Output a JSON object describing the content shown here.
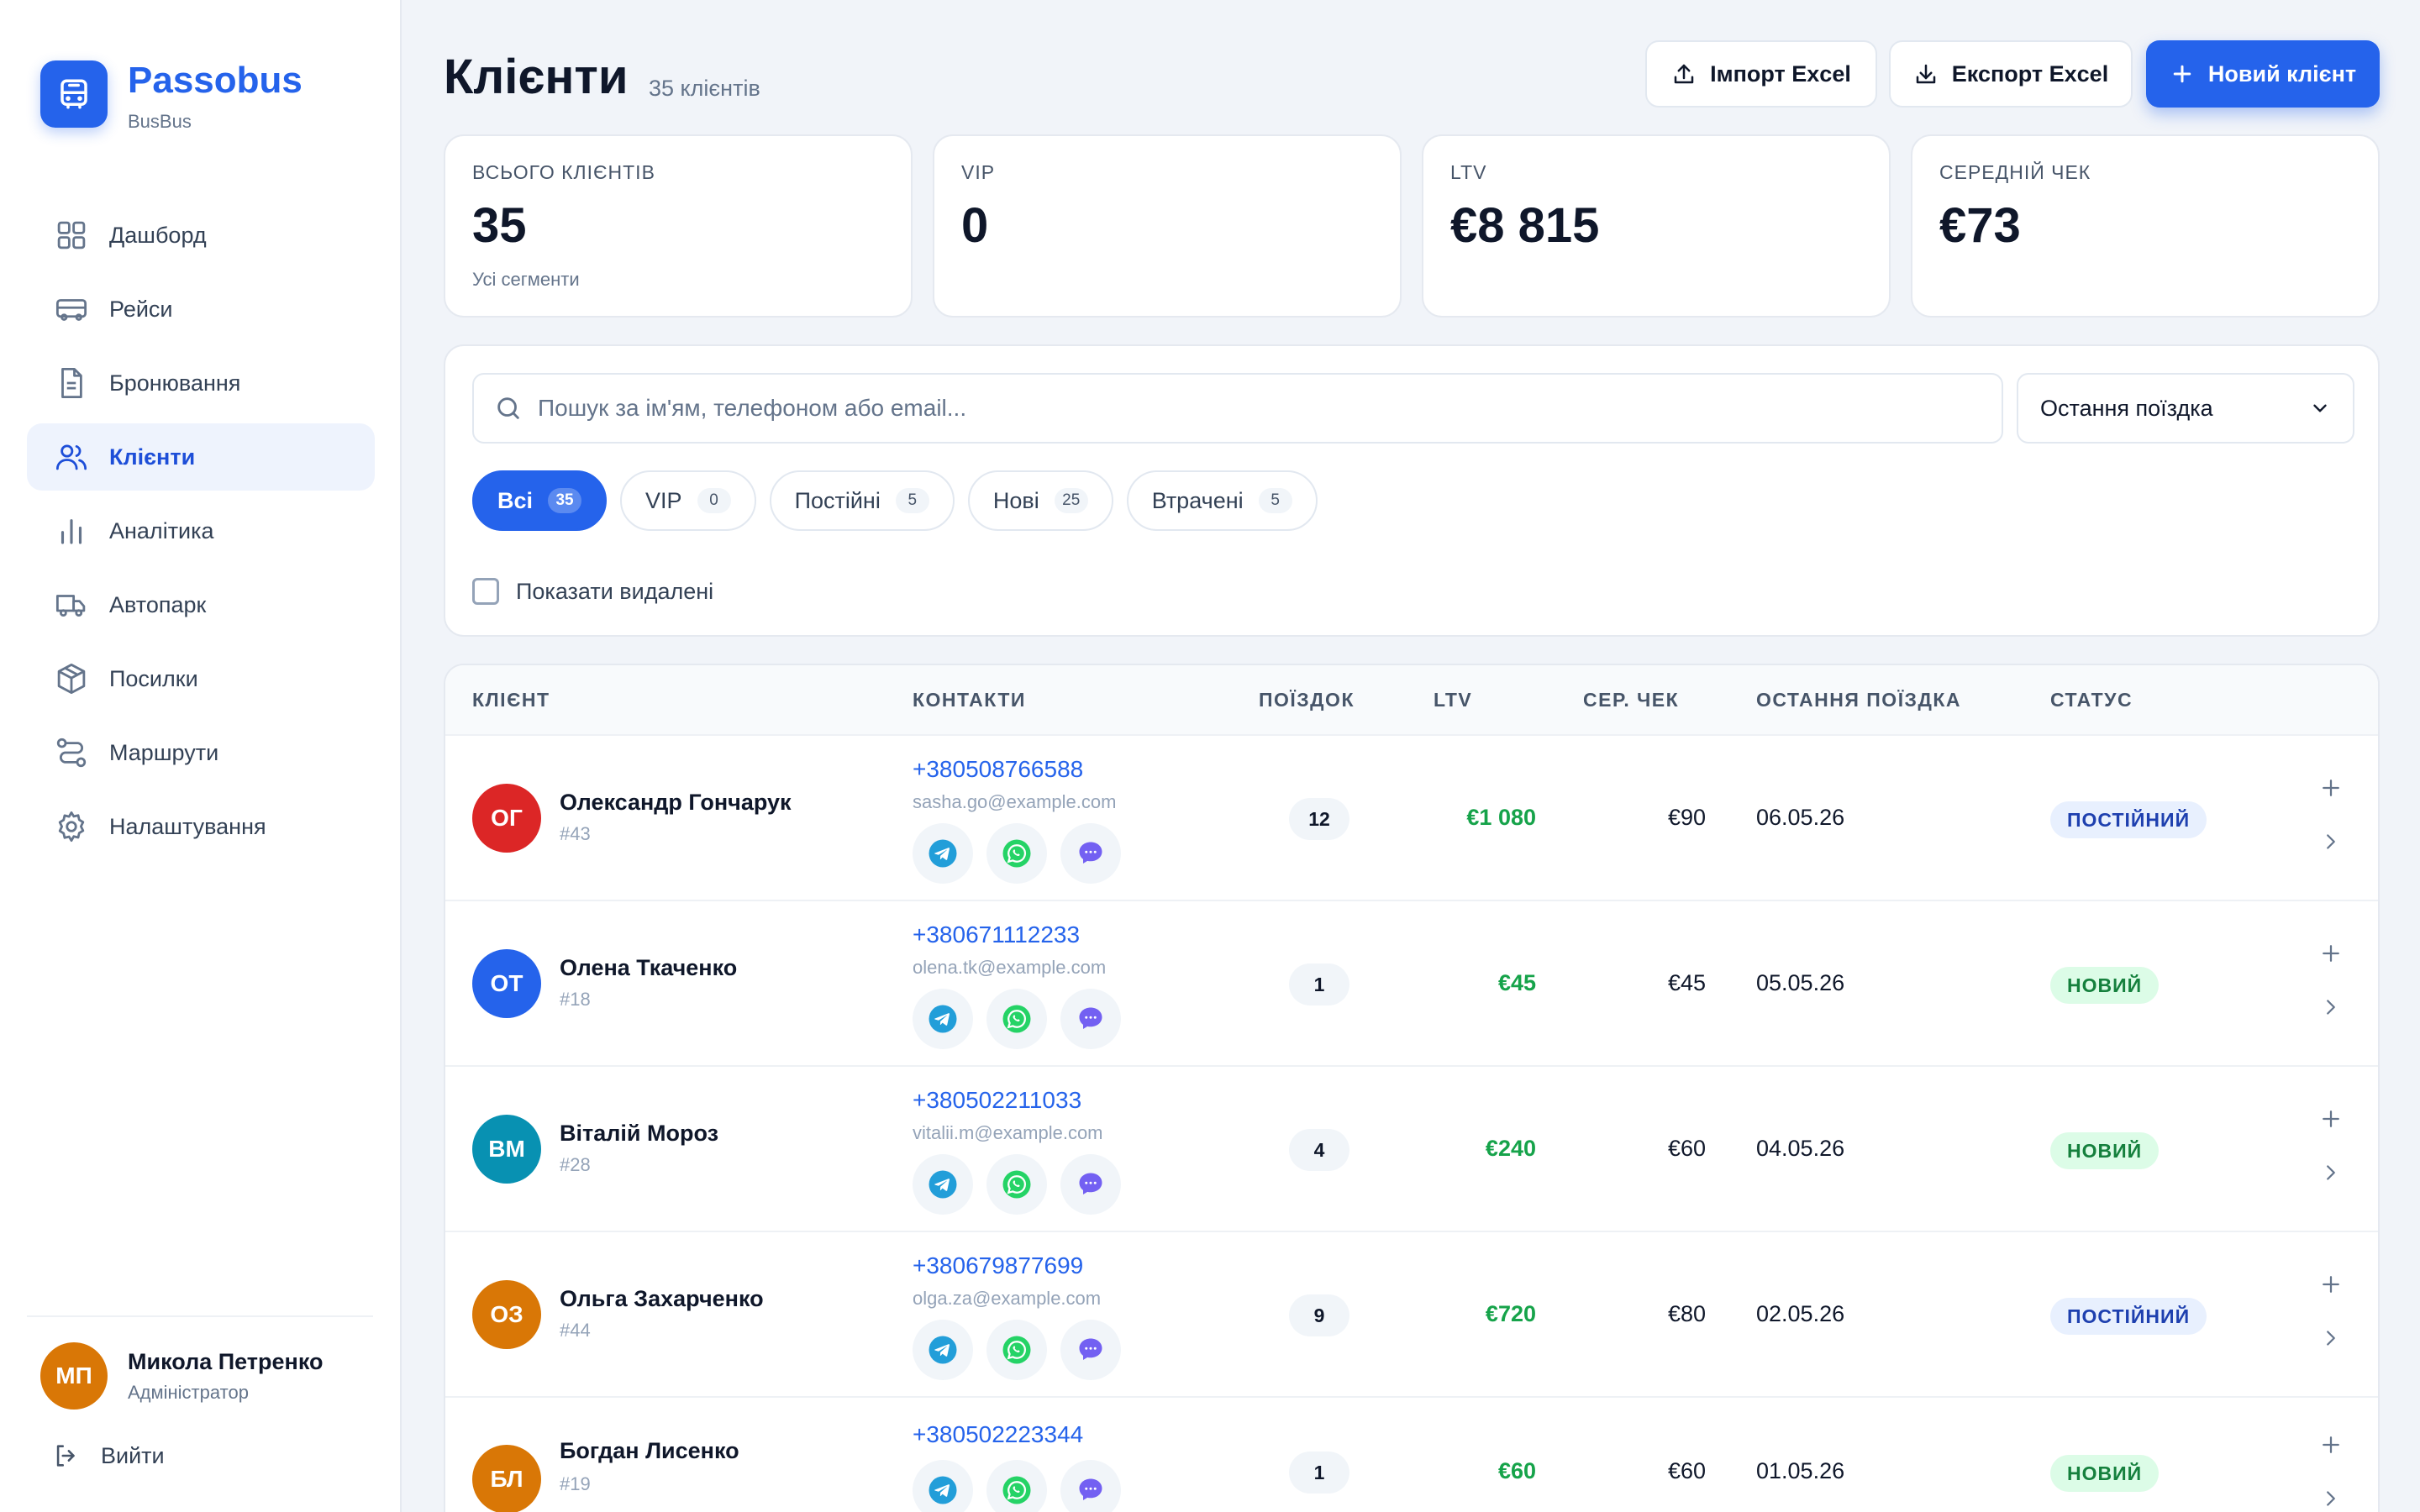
{
  "brand": {
    "name": "Passobus",
    "sub": "BusBus",
    "accent": "#2563eb"
  },
  "nav": [
    {
      "label": "Дашборд",
      "icon": "grid-icon",
      "active": false
    },
    {
      "label": "Рейси",
      "icon": "bus-icon",
      "active": false
    },
    {
      "label": "Бронювання",
      "icon": "document-icon",
      "active": false
    },
    {
      "label": "Клієнти",
      "icon": "users-icon",
      "active": true
    },
    {
      "label": "Аналітика",
      "icon": "bar-chart-icon",
      "active": false
    },
    {
      "label": "Автопарк",
      "icon": "truck-icon",
      "active": false
    },
    {
      "label": "Посилки",
      "icon": "package-icon",
      "active": false
    },
    {
      "label": "Маршрути",
      "icon": "route-icon",
      "active": false
    },
    {
      "label": "Налаштування",
      "icon": "gear-icon",
      "active": false
    }
  ],
  "user": {
    "initials": "МП",
    "name": "Микола Петренко",
    "role": "Адміністратор",
    "color": "#d97706"
  },
  "logout_label": "Вийти",
  "header": {
    "title": "Клієнти",
    "count": "35 клієнтів",
    "import_label": "Імпорт Excel",
    "export_label": "Експорт Excel",
    "new_label": "Новий клієнт"
  },
  "stats": [
    {
      "label": "ВСЬОГО КЛІЄНТІВ",
      "value": "35",
      "hint": "Усі сегменти"
    },
    {
      "label": "VIP",
      "value": "0",
      "hint": ""
    },
    {
      "label": "LTV",
      "value": "€8 815",
      "hint": ""
    },
    {
      "label": "СЕРЕДНІЙ ЧЕК",
      "value": "€73",
      "hint": ""
    }
  ],
  "filters": {
    "search_placeholder": "Пошук за ім'ям, телефоном або email...",
    "sort_value": "Остання поїздка",
    "segments": [
      {
        "label": "Всі",
        "count": "35",
        "active": true
      },
      {
        "label": "VIP",
        "count": "0",
        "active": false
      },
      {
        "label": "Постійні",
        "count": "5",
        "active": false
      },
      {
        "label": "Нові",
        "count": "25",
        "active": false
      },
      {
        "label": "Втрачені",
        "count": "5",
        "active": false
      }
    ],
    "show_deleted_label": "Показати видалені"
  },
  "table": {
    "columns": {
      "client": "КЛІЄНТ",
      "contacts": "КОНТАКТИ",
      "trips": "ПОЇЗДОК",
      "ltv": "LTV",
      "avg": "СЕР. ЧЕК",
      "last": "ОСТАННЯ ПОЇЗДКА",
      "status": "СТАТУС"
    },
    "rows": [
      {
        "initials": "ОГ",
        "color": "#dc2626",
        "name": "Олександр Гончарук",
        "id": "#43",
        "phone": "+380508766588",
        "email": "sasha.go@example.com",
        "trips": "12",
        "ltv": "€1 080",
        "avg": "€90",
        "last": "06.05.26",
        "status": "ПОСТІЙНИЙ",
        "status_type": "reg"
      },
      {
        "initials": "ОТ",
        "color": "#2563eb",
        "name": "Олена Ткаченко",
        "id": "#18",
        "phone": "+380671112233",
        "email": "olena.tk@example.com",
        "trips": "1",
        "ltv": "€45",
        "avg": "€45",
        "last": "05.05.26",
        "status": "НОВИЙ",
        "status_type": "new"
      },
      {
        "initials": "ВМ",
        "color": "#0891b2",
        "name": "Віталій Мороз",
        "id": "#28",
        "phone": "+380502211033",
        "email": "vitalii.m@example.com",
        "trips": "4",
        "ltv": "€240",
        "avg": "€60",
        "last": "04.05.26",
        "status": "НОВИЙ",
        "status_type": "new"
      },
      {
        "initials": "ОЗ",
        "color": "#d97706",
        "name": "Ольга Захарченко",
        "id": "#44",
        "phone": "+380679877699",
        "email": "olga.za@example.com",
        "trips": "9",
        "ltv": "€720",
        "avg": "€80",
        "last": "02.05.26",
        "status": "ПОСТІЙНИЙ",
        "status_type": "reg"
      },
      {
        "initials": "БЛ",
        "color": "#d97706",
        "name": "Богдан Лисенко",
        "id": "#19",
        "phone": "+380502223344",
        "email": "",
        "trips": "1",
        "ltv": "€60",
        "avg": "€60",
        "last": "01.05.26",
        "status": "НОВИЙ",
        "status_type": "new"
      }
    ]
  }
}
